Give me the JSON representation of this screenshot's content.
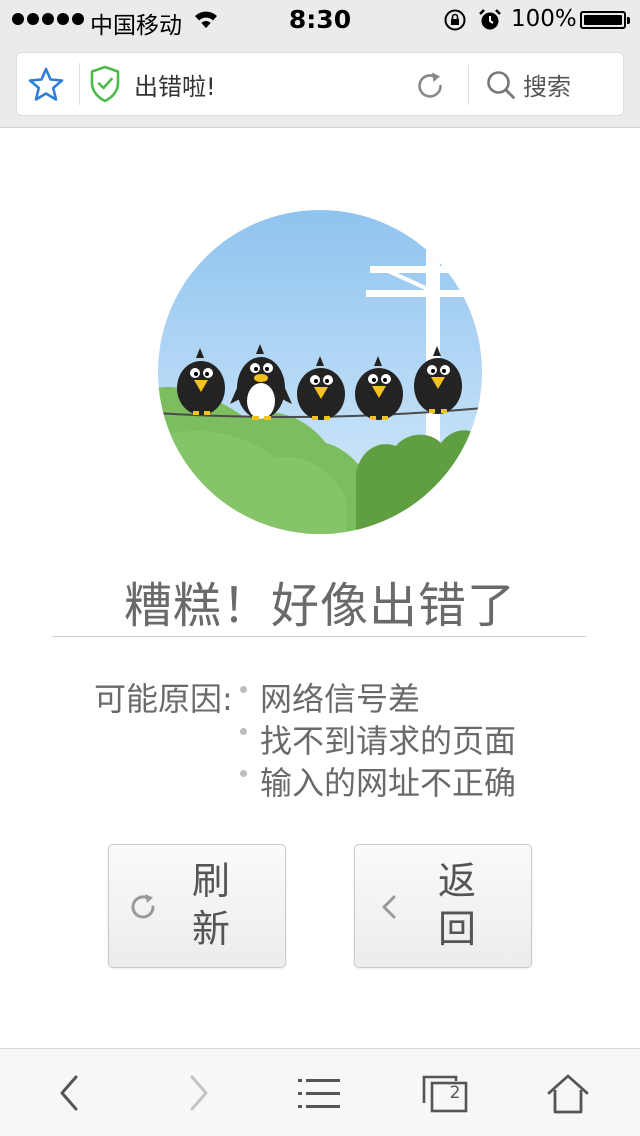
{
  "status_bar": {
    "carrier": "中国移动",
    "time": "8:30",
    "battery": "100%"
  },
  "address_bar": {
    "title": "出错啦!",
    "search_label": "搜索",
    "icons": [
      "star-icon",
      "shield-check-icon",
      "reload-icon",
      "search-icon"
    ],
    "shield_color": "#4cbb4a",
    "star_color": "#2e7fd6"
  },
  "error": {
    "title": "糟糕！好像出错了",
    "reasons_label": "可能原因:",
    "reasons": [
      "网络信号差",
      "找不到请求的页面",
      "输入的网址不正确"
    ]
  },
  "buttons": {
    "refresh": "刷新",
    "back": "返回"
  },
  "toolbar": {
    "tabs_count": "2",
    "icons": [
      "back-arrow-icon",
      "forward-arrow-icon",
      "menu-list-icon",
      "tabs-icon",
      "home-icon"
    ]
  }
}
